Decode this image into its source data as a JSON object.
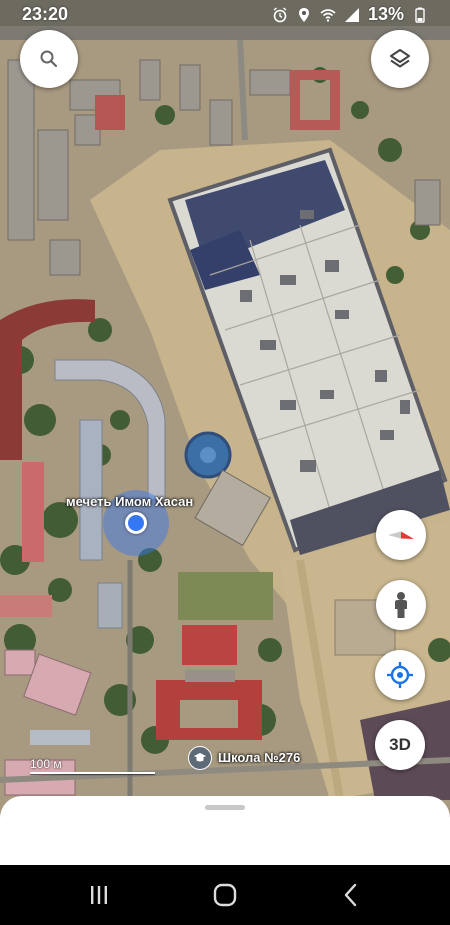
{
  "status_bar": {
    "time": "23:20",
    "battery": "13%",
    "icons": [
      "alarm-icon",
      "location-icon",
      "wifi-icon",
      "signal-icon",
      "battery-icon"
    ]
  },
  "map": {
    "mode": "satellite",
    "labels": {
      "mosque": "мечеть Имом Хасан",
      "school": "Школа №276"
    },
    "scale": "100 м",
    "colors": {
      "location_dot": "#3478f6",
      "compass_red": "#e53935"
    }
  },
  "controls": {
    "search_icon": "search-icon",
    "layers_icon": "layers-icon",
    "compass_icon": "compass-icon",
    "pegman_icon": "pegman-icon",
    "my_location_icon": "my-location-icon",
    "three_d_label": "3D"
  },
  "nav_bar": {
    "buttons": [
      "recent-apps-icon",
      "home-icon",
      "back-icon"
    ]
  }
}
